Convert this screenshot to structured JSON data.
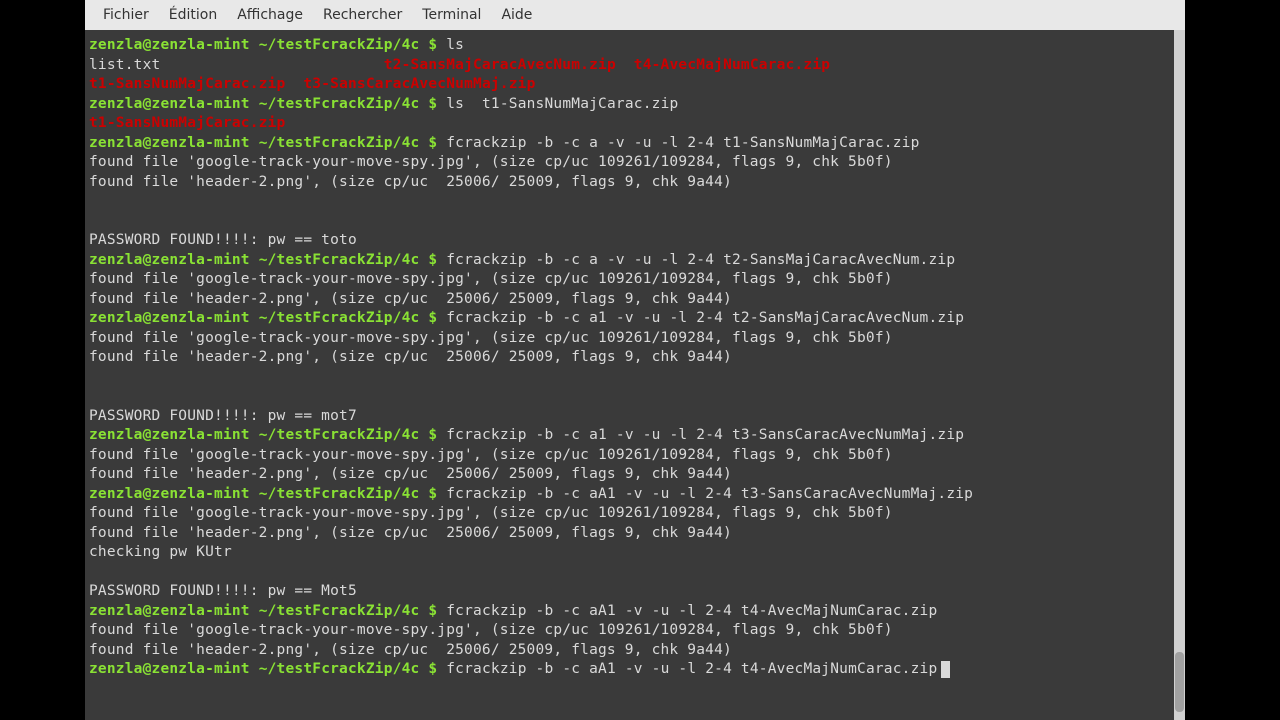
{
  "menubar": {
    "file": "Fichier",
    "edit": "Édition",
    "view": "Affichage",
    "search": "Rechercher",
    "terminal": "Terminal",
    "help": "Aide"
  },
  "prompt": {
    "user_host": "zenzla@zenzla-mint",
    "path": "~/testFcrackZip/4c",
    "symbol": "$"
  },
  "files": {
    "list_txt": "list.txt",
    "t1": "t1-SansNumMajCarac.zip",
    "t2": "t2-SansMajCaracAvecNum.zip",
    "t3": "t3-SansCaracAvecNumMaj.zip",
    "t4": "t4-AvecMajNumCarac.zip"
  },
  "commands": {
    "ls": "ls",
    "ls_t1": "ls  t1-SansNumMajCarac.zip",
    "fc_t1": "fcrackzip -b -c a -v -u -l 2-4 t1-SansNumMajCarac.zip",
    "fc_t2a": "fcrackzip -b -c a -v -u -l 2-4 t2-SansMajCaracAvecNum.zip",
    "fc_t2b": "fcrackzip -b -c a1 -v -u -l 2-4 t2-SansMajCaracAvecNum.zip",
    "fc_t3a": "fcrackzip -b -c a1 -v -u -l 2-4 t3-SansCaracAvecNumMaj.zip",
    "fc_t3b": "fcrackzip -b -c aA1 -v -u -l 2-4 t3-SansCaracAvecNumMaj.zip",
    "fc_t4a": "fcrackzip -b -c aA1 -v -u -l 2-4 t4-AvecMajNumCarac.zip",
    "fc_t4b": "fcrackzip -b -c aA1 -v -u -l 2-4 t4-AvecMajNumCarac.zip"
  },
  "output": {
    "found_jpg": "found file 'google-track-your-move-spy.jpg', (size cp/uc 109261/109284, flags 9, chk 5b0f)",
    "found_png": "found file 'header-2.png', (size cp/uc  25006/ 25009, flags 9, chk 9a44)",
    "checking": "checking pw KUtr",
    "pw_toto": "PASSWORD FOUND!!!!: pw == toto",
    "pw_mot7": "PASSWORD FOUND!!!!: pw == mot7",
    "pw_Mot5": "PASSWORD FOUND!!!!: pw == Mot5",
    "pad": "                         "
  }
}
